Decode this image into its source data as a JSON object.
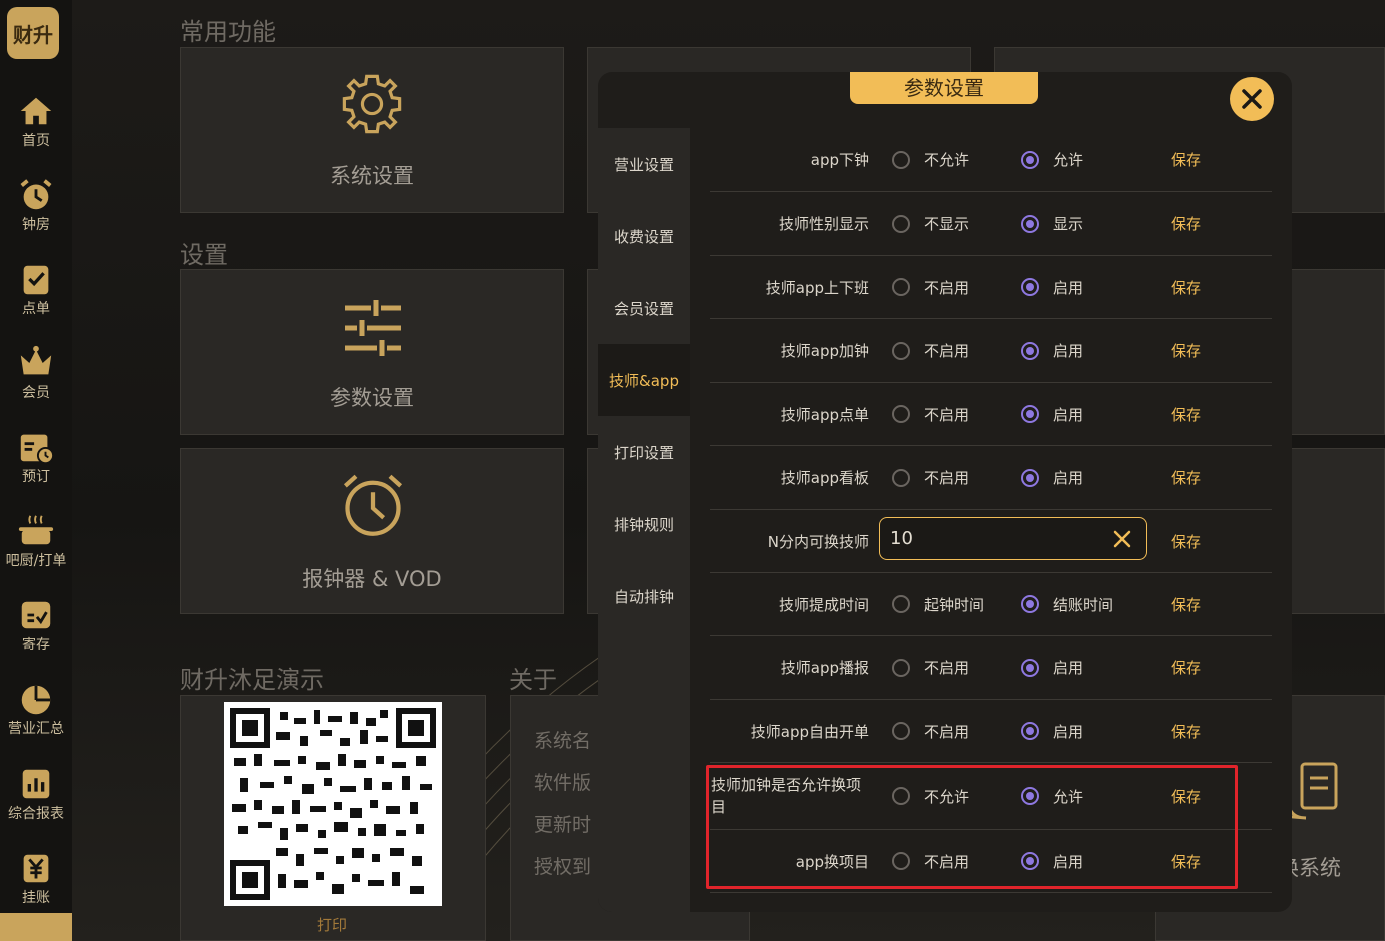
{
  "logo": "财升",
  "nav": [
    {
      "label": "首页",
      "icon": "home-icon"
    },
    {
      "label": "钟房",
      "icon": "alarm-clock-icon"
    },
    {
      "label": "点单",
      "icon": "checklist-icon"
    },
    {
      "label": "会员",
      "icon": "crown-icon"
    },
    {
      "label": "预订",
      "icon": "calendar-clock-icon"
    },
    {
      "label": "吧厨/打单",
      "icon": "cooking-pot-icon"
    },
    {
      "label": "寄存",
      "icon": "storage-box-icon"
    },
    {
      "label": "营业汇总",
      "icon": "pie-chart-icon"
    },
    {
      "label": "综合报表",
      "icon": "report-icon"
    },
    {
      "label": "挂账",
      "icon": "yen-icon"
    }
  ],
  "main": {
    "section_common": "常用功能",
    "section_settings": "设置",
    "card_system": "系统设置",
    "card_params": "参数设置",
    "card_clock": "报钟器 & VOD",
    "section_demo": "财升沐足演示",
    "section_about": "关于",
    "about_lines": [
      "系统名",
      "软件版",
      "更新时",
      "授权到"
    ],
    "print": "打印",
    "switch_system": "换系统"
  },
  "modal": {
    "title": "参数设置",
    "tabs": [
      {
        "label": "营业设置",
        "active": false
      },
      {
        "label": "收费设置",
        "active": false
      },
      {
        "label": "会员设置",
        "active": false
      },
      {
        "label": "技师&app",
        "active": true
      },
      {
        "label": "打印设置",
        "active": false
      },
      {
        "label": "排钟规则",
        "active": false
      },
      {
        "label": "自动排钟",
        "active": false
      }
    ],
    "save_label": "保存",
    "rows": [
      {
        "label": "app下钟",
        "opt1": "不允许",
        "opt2": "允许",
        "selected": 2
      },
      {
        "label": "技师性别显示",
        "opt1": "不显示",
        "opt2": "显示",
        "selected": 2
      },
      {
        "label": "技师app上下班",
        "opt1": "不启用",
        "opt2": "启用",
        "selected": 2
      },
      {
        "label": "技师app加钟",
        "opt1": "不启用",
        "opt2": "启用",
        "selected": 2
      },
      {
        "label": "技师app点单",
        "opt1": "不启用",
        "opt2": "启用",
        "selected": 2
      },
      {
        "label": "技师app看板",
        "opt1": "不启用",
        "opt2": "启用",
        "selected": 2
      },
      {
        "label": "N分内可换技师",
        "input": "10"
      },
      {
        "label": "技师提成时间",
        "opt1": "起钟时间",
        "opt2": "结账时间",
        "selected": 2
      },
      {
        "label": "技师app播报",
        "opt1": "不启用",
        "opt2": "启用",
        "selected": 2
      },
      {
        "label": "技师app自由开单",
        "opt1": "不启用",
        "opt2": "启用",
        "selected": 2
      },
      {
        "label": "技师加钟是否允许换项目",
        "opt1": "不允许",
        "opt2": "允许",
        "selected": 2
      },
      {
        "label": "app换项目",
        "opt1": "不启用",
        "opt2": "启用",
        "selected": 2
      }
    ]
  },
  "colors": {
    "accent": "#f2bd57",
    "radio": "#8e78e0",
    "highlight": "#e0242b"
  }
}
